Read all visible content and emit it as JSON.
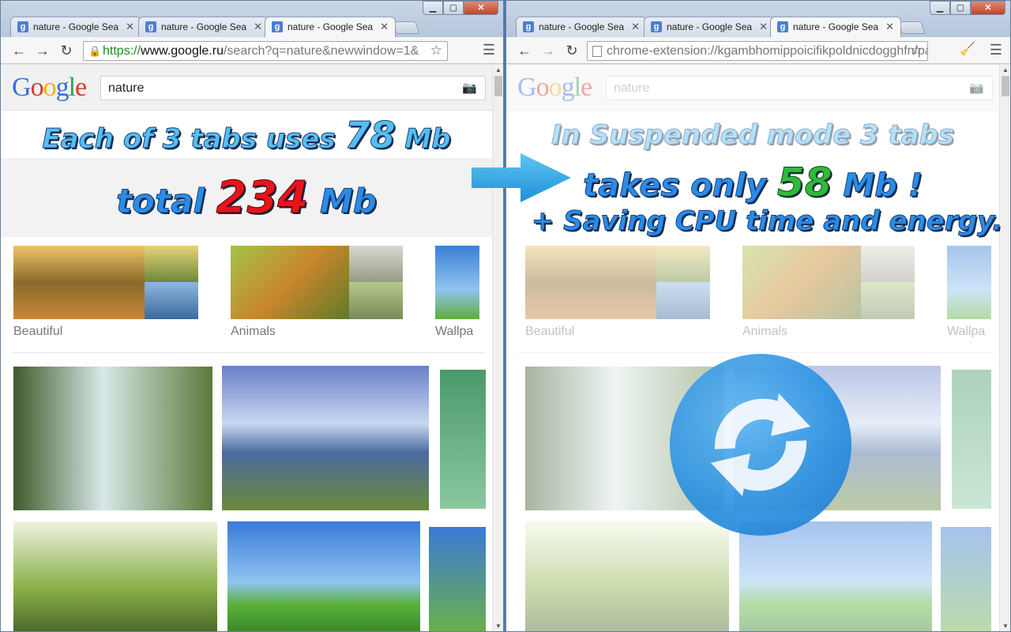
{
  "left_window": {
    "tabs": [
      {
        "title": "nature - Google Sea",
        "active": false
      },
      {
        "title": "nature - Google Sea",
        "active": false
      },
      {
        "title": "nature - Google Sea",
        "active": true
      }
    ],
    "url_scheme": "https://",
    "url_host": "www.google.ru",
    "url_rest": "/search?q=nature&newwindow=1&",
    "search_value": "nature",
    "banner_line1_a": "Each of 3 tabs uses",
    "banner_line1_num": "78",
    "banner_line1_unit": "Mb",
    "banner_line2_a": "total",
    "banner_line2_num": "234",
    "banner_line2_unit": "Mb",
    "categories": [
      "Beautiful",
      "Animals",
      "Wallpa"
    ]
  },
  "right_window": {
    "tabs": [
      {
        "title": "nature - Google Sea",
        "active": false
      },
      {
        "title": "nature - Google Sea",
        "active": false
      },
      {
        "title": "nature - Google Sea",
        "active": true
      }
    ],
    "url": "chrome-extension://kgambhomippoicifikpoldnicdogghfn/pa",
    "search_value": "nature",
    "banner_line1": "In Suspended mode 3 tabs",
    "banner_line2_a": "takes only",
    "banner_line2_num": "58",
    "banner_line2_unit": "Mb",
    "banner_line2_excl": "!",
    "banner_line3": "+ Saving CPU time and energy.",
    "categories": [
      "Beautiful",
      "Animals",
      "Wallpa"
    ]
  },
  "google_logo": "Google",
  "icons": [
    "back-arrow-icon",
    "forward-arrow-icon",
    "reload-icon",
    "lock-icon",
    "star-icon",
    "menu-icon",
    "camera-icon",
    "extension-icon",
    "big-arrow-icon",
    "reload-circle-icon"
  ],
  "colors": {
    "banner_blue": "#55bff0",
    "red_number": "#e8141b",
    "green_number": "#31b93c",
    "arrow_blue": "#2aa5e6"
  }
}
